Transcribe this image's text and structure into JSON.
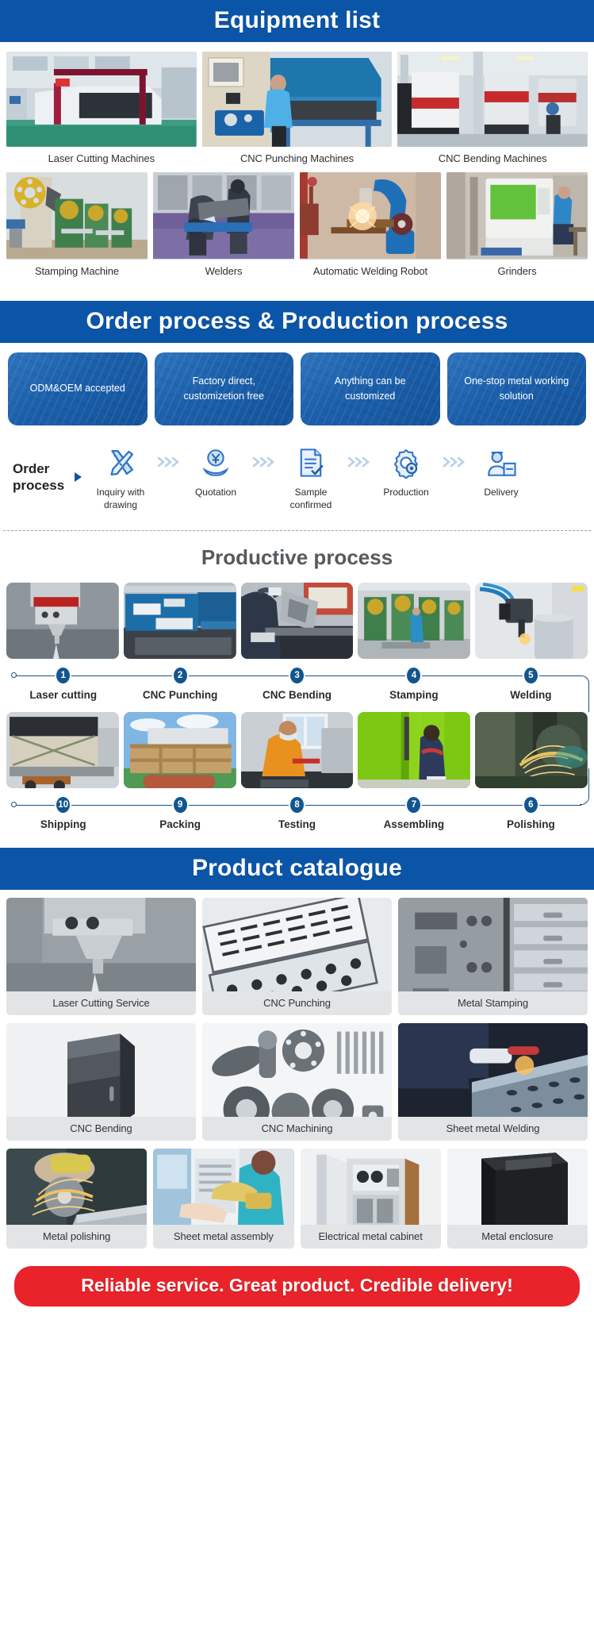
{
  "sections": {
    "equipment": {
      "title": "Equipment list",
      "row1": [
        {
          "label": "Laser Cutting Machines",
          "image": "laser-cutting-machine-photo"
        },
        {
          "label": "CNC Punching Machines",
          "image": "cnc-punching-machine-photo"
        },
        {
          "label": "CNC Bending Machines",
          "image": "cnc-bending-machine-photo"
        }
      ],
      "row2": [
        {
          "label": "Stamping Machine",
          "image": "stamping-machine-photo"
        },
        {
          "label": "Welders",
          "image": "welders-photo"
        },
        {
          "label": "Automatic Welding Robot",
          "image": "welding-robot-photo"
        },
        {
          "label": "Grinders",
          "image": "grinders-photo"
        }
      ]
    },
    "order": {
      "title": "Order process & Production process",
      "cards": [
        "ODM&OEM accepted",
        "Factory direct, customizetion free",
        "Anything can be customized",
        "One-stop metal working solution"
      ],
      "flow_label_line1": "Order",
      "flow_label_line2": "process",
      "steps": [
        {
          "label": "Inquiry with drawing",
          "icon": "ruler-pencil-icon"
        },
        {
          "label": "Quotation",
          "icon": "yuan-coin-hand-icon"
        },
        {
          "label": "Sample confirmed",
          "icon": "document-check-icon"
        },
        {
          "label": "Production",
          "icon": "gear-settings-icon"
        },
        {
          "label": "Delivery",
          "icon": "delivery-person-icon"
        }
      ]
    },
    "productive": {
      "title": "Productive process",
      "row1": [
        {
          "num": "1",
          "label": "Laser cutting",
          "image": "laser-cutting-head-photo"
        },
        {
          "num": "2",
          "label": "CNC Punching",
          "image": "cnc-punch-press-photo"
        },
        {
          "num": "3",
          "label": "CNC Bending",
          "image": "press-brake-operator-photo"
        },
        {
          "num": "4",
          "label": "Stamping",
          "image": "stamping-shop-photo"
        },
        {
          "num": "5",
          "label": "Welding",
          "image": "robot-welding-photo"
        }
      ],
      "row2": [
        {
          "num": "10",
          "label": "Shipping",
          "image": "truck-loading-photo"
        },
        {
          "num": "9",
          "label": "Packing",
          "image": "wooden-crates-photo"
        },
        {
          "num": "8",
          "label": "Testing",
          "image": "inspection-worker-photo"
        },
        {
          "num": "7",
          "label": "Assembling",
          "image": "assembly-worker-photo"
        },
        {
          "num": "6",
          "label": "Polishing",
          "image": "grinding-sparks-photo"
        }
      ]
    },
    "catalogue": {
      "title": "Product catalogue",
      "row1": [
        {
          "label": "Laser Cutting Service",
          "image": "laser-cut-nozzle-photo"
        },
        {
          "label": "CNC Punching",
          "image": "perforated-sheets-photo"
        },
        {
          "label": "Metal Stamping",
          "image": "stamped-parts-photo"
        }
      ],
      "row2": [
        {
          "label": "CNC Bending",
          "image": "bent-metal-part-photo"
        },
        {
          "label": "CNC Machining",
          "image": "machined-parts-photo"
        },
        {
          "label": "Sheet metal Welding",
          "image": "sheet-welding-photo"
        }
      ],
      "row3": [
        {
          "label": "Metal polishing",
          "image": "angle-grinder-photo"
        },
        {
          "label": "Sheet metal assembly",
          "image": "panel-assembly-photo"
        },
        {
          "label": "Electrical metal cabinet",
          "image": "electrical-cabinet-photo"
        },
        {
          "label": "Metal enclosure",
          "image": "black-enclosure-photo"
        }
      ]
    },
    "footer": {
      "slogan": "Reliable service. Great product. Credible delivery!"
    }
  },
  "colors": {
    "brand_blue": "#0b55a8",
    "card_blue": "#1b5fab",
    "accent_red": "#e8232a",
    "badge_blue": "#12558f",
    "caption_grey": "#e2e4e6"
  }
}
